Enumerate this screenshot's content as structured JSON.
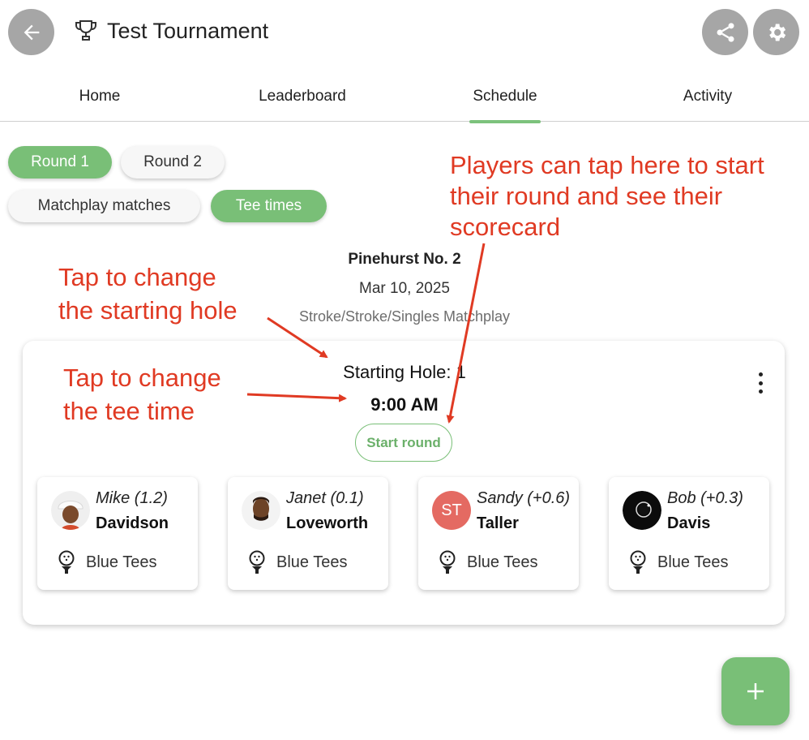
{
  "header": {
    "title": "Test Tournament",
    "back_icon": "arrow-left-icon",
    "trophy_icon": "trophy-icon",
    "share_icon": "share-icon",
    "settings_icon": "gear-icon"
  },
  "tabs": [
    {
      "label": "Home",
      "active": false
    },
    {
      "label": "Leaderboard",
      "active": false
    },
    {
      "label": "Schedule",
      "active": true
    },
    {
      "label": "Activity",
      "active": false
    }
  ],
  "filters": {
    "rounds": [
      {
        "label": "Round 1",
        "selected": true
      },
      {
        "label": "Round 2",
        "selected": false
      }
    ],
    "views": [
      {
        "label": "Matchplay matches",
        "selected": false
      },
      {
        "label": "Tee times",
        "selected": true
      }
    ]
  },
  "course": {
    "name": "Pinehurst No. 2",
    "date": "Mar 10, 2025",
    "format": "Stroke/Stroke/Singles Matchplay"
  },
  "group": {
    "starting_hole": "Starting Hole: 1",
    "tee_time": "9:00 AM",
    "start_label": "Start round",
    "menu_icon": "more-vert-icon",
    "players": [
      {
        "first": "Mike (1.2)",
        "last": "Davidson",
        "tee": "Blue Tees",
        "avatar": "photo"
      },
      {
        "first": "Janet (0.1)",
        "last": "Loveworth",
        "tee": "Blue Tees",
        "avatar": "photo"
      },
      {
        "first": "Sandy (+0.6)",
        "last": "Taller",
        "tee": "Blue Tees",
        "avatar": "ST"
      },
      {
        "first": "Bob (+0.3)",
        "last": "Davis",
        "tee": "Blue Tees",
        "avatar": "photo"
      }
    ]
  },
  "fab_icon": "plus-icon",
  "annotations": {
    "start_round_line1": "Players can tap here to start",
    "start_round_line2": "their round and see their",
    "start_round_line3": "scorecard",
    "starting_hole_line1": "Tap to change",
    "starting_hole_line2": "the starting hole",
    "tee_time_line1": "Tap to change",
    "tee_time_line2": "the tee time"
  },
  "colors": {
    "accent_green": "#79bf77",
    "annotation_red": "#e03a23",
    "icon_gray": "#a6a6a6",
    "initials_avatar": "#e46a62"
  }
}
